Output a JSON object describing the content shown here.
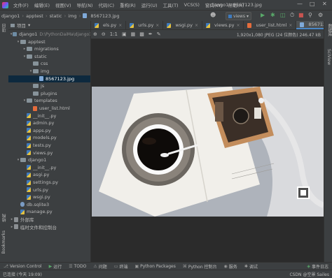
{
  "menu": {
    "items": [
      "文件(F)",
      "编辑(E)",
      "视图(V)",
      "导航(N)",
      "代码(C)",
      "重构(R)",
      "运行(U)",
      "工具(T)",
      "VCS(S)",
      "窗口(W)",
      "帮助(H)"
    ],
    "window_title": "django1 - 8567123.jpg"
  },
  "breadcrumb": {
    "items": [
      "django1",
      "apptest",
      "static",
      "img",
      "8567123.jpg"
    ],
    "run_config": "views"
  },
  "project_panel": {
    "title": "项目",
    "tree": [
      {
        "label": "django1",
        "extra": "D:\\PythonDaiMa\\django1",
        "type": "folder-blue",
        "depth": 0,
        "open": true
      },
      {
        "label": "apptest",
        "type": "folder",
        "depth": 1,
        "open": true
      },
      {
        "label": "migrations",
        "type": "folder",
        "depth": 2,
        "open": false
      },
      {
        "label": "static",
        "type": "folder",
        "depth": 2,
        "open": true
      },
      {
        "label": "css",
        "type": "folder",
        "depth": 3,
        "open": null
      },
      {
        "label": "img",
        "type": "folder",
        "depth": 3,
        "open": true
      },
      {
        "label": "8567123.jpg",
        "type": "jpg",
        "depth": 4,
        "selected": true
      },
      {
        "label": "js",
        "type": "folder",
        "depth": 3,
        "open": null
      },
      {
        "label": "plugins",
        "type": "folder",
        "depth": 3,
        "open": null
      },
      {
        "label": "templates",
        "type": "folder",
        "depth": 2,
        "open": true
      },
      {
        "label": "user_list.html",
        "type": "html",
        "depth": 3
      },
      {
        "label": "__init__.py",
        "type": "py",
        "depth": 2
      },
      {
        "label": "admin.py",
        "type": "py",
        "depth": 2
      },
      {
        "label": "apps.py",
        "type": "py",
        "depth": 2
      },
      {
        "label": "models.py",
        "type": "py",
        "depth": 2
      },
      {
        "label": "tests.py",
        "type": "py",
        "depth": 2
      },
      {
        "label": "views.py",
        "type": "py",
        "depth": 2
      },
      {
        "label": "django1",
        "type": "folder",
        "depth": 1,
        "open": true
      },
      {
        "label": "__init__.py",
        "type": "py",
        "depth": 2
      },
      {
        "label": "asgi.py",
        "type": "py",
        "depth": 2
      },
      {
        "label": "settings.py",
        "type": "py",
        "depth": 2
      },
      {
        "label": "urls.py",
        "type": "py",
        "depth": 2
      },
      {
        "label": "wsgi.py",
        "type": "py",
        "depth": 2
      },
      {
        "label": "db.sqlite3",
        "type": "db",
        "depth": 1
      },
      {
        "label": "manage.py",
        "type": "py",
        "depth": 1
      },
      {
        "label": "外部库",
        "type": "lib",
        "depth": 0,
        "open": false
      },
      {
        "label": "临时文件和控制台",
        "type": "lib",
        "depth": 0,
        "open": false
      }
    ]
  },
  "left_strip": {
    "project": "项目",
    "structure": "结构",
    "bookmarks": "Bookmarks"
  },
  "right_strip": {
    "db": "数据库",
    "sciview": "SciView"
  },
  "editor_tabs": [
    {
      "label": "els.py",
      "active": false
    },
    {
      "label": "urls.py",
      "active": false
    },
    {
      "label": "wsgi.py",
      "active": false
    },
    {
      "label": "views.py",
      "active": false
    },
    {
      "label": "user_list.html",
      "active": false
    },
    {
      "label": "8567123.jpg",
      "active": true
    }
  ],
  "image_toolbar": {
    "info": "1,920x1,080 JPEG (24 位颜色) 246.47 kB"
  },
  "bottom_tools": [
    {
      "label": "Version Control",
      "icon": "vcs-icon"
    },
    {
      "label": "运行",
      "icon": "run-icon"
    },
    {
      "label": "TODO",
      "icon": "todo-icon"
    },
    {
      "label": "问题",
      "icon": "problems-icon"
    },
    {
      "label": "终端",
      "icon": "terminal-icon"
    },
    {
      "label": "Python Packages",
      "icon": "packages-icon"
    },
    {
      "label": "Python 控制台",
      "icon": "console-icon"
    },
    {
      "label": "服务",
      "icon": "services-icon"
    },
    {
      "label": "调试",
      "icon": "debug-icon"
    },
    {
      "label": "事件日志",
      "icon": "eventlog-icon"
    }
  ],
  "status_bar": {
    "left": "已连接 (今天 19:09)",
    "right": "CSDN @空景 Sailes"
  },
  "colors": {
    "selection": "#0d293e",
    "accent": "#4a88c7",
    "panel": "#3c3f41",
    "editor": "#2b2b2b"
  }
}
